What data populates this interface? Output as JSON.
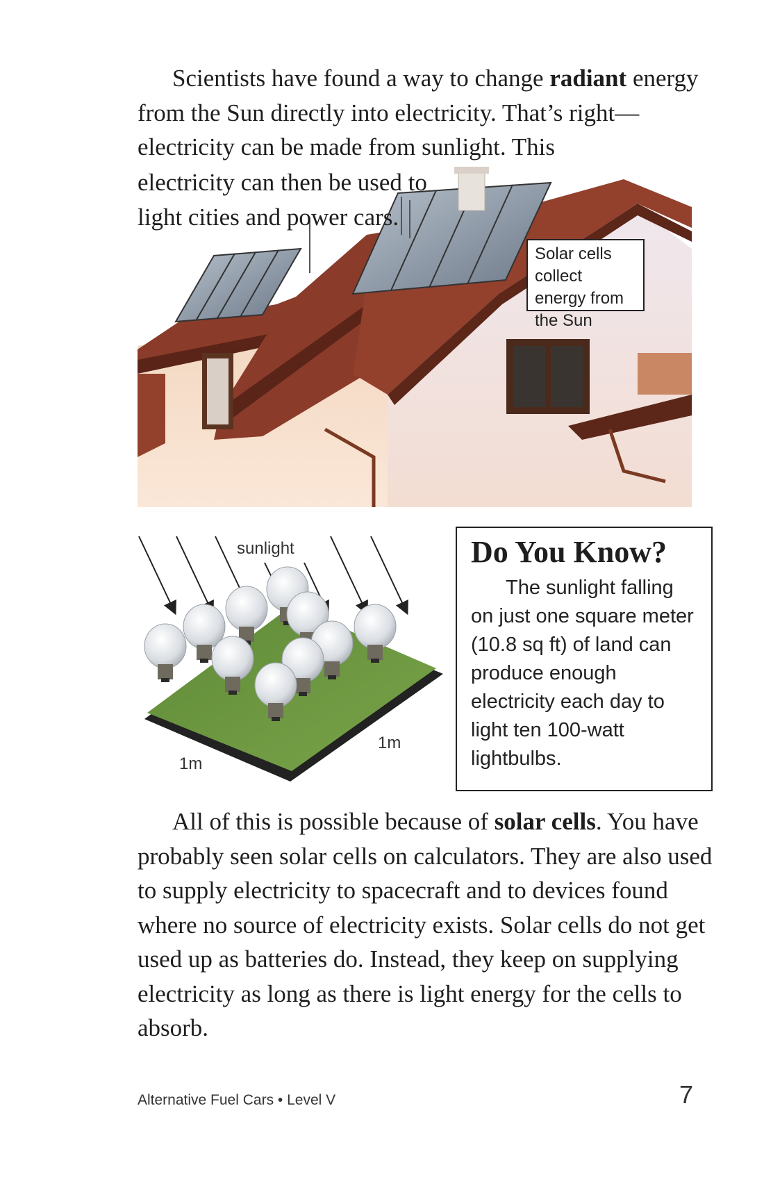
{
  "intro": {
    "text1": "Scientists have found a way to change ",
    "bold1": "radiant",
    "text2": " energy from the Sun directly into electricity. That’s right—electricity can be made from sunlight. This",
    "side_text": "electricity can then be used to light cities and power cars."
  },
  "photo": {
    "callout": "Solar cells collect energy from the Sun"
  },
  "diagram": {
    "sunlight_label": "sunlight",
    "width_label": "1m",
    "depth_label": "1m"
  },
  "sidebar": {
    "title": "Do You Know?",
    "text": "The sunlight falling on just one square meter (10.8 sq ft) of land can produce enough electricity each day to light ten 100-watt lightbulbs."
  },
  "body2": {
    "text1": "All of this is possible because of ",
    "bold1": "solar cells",
    "text2": ". You have probably seen solar cells on calculators. They are also used to supply electricity to spacecraft and to devices found where no source of electricity exists. Solar cells do not get used up as batteries do. Instead, they keep on supplying electricity as long as there is light energy for the cells to absorb."
  },
  "footer": {
    "book_title": "Alternative Fuel Cars • Level V",
    "page_number": "7"
  }
}
